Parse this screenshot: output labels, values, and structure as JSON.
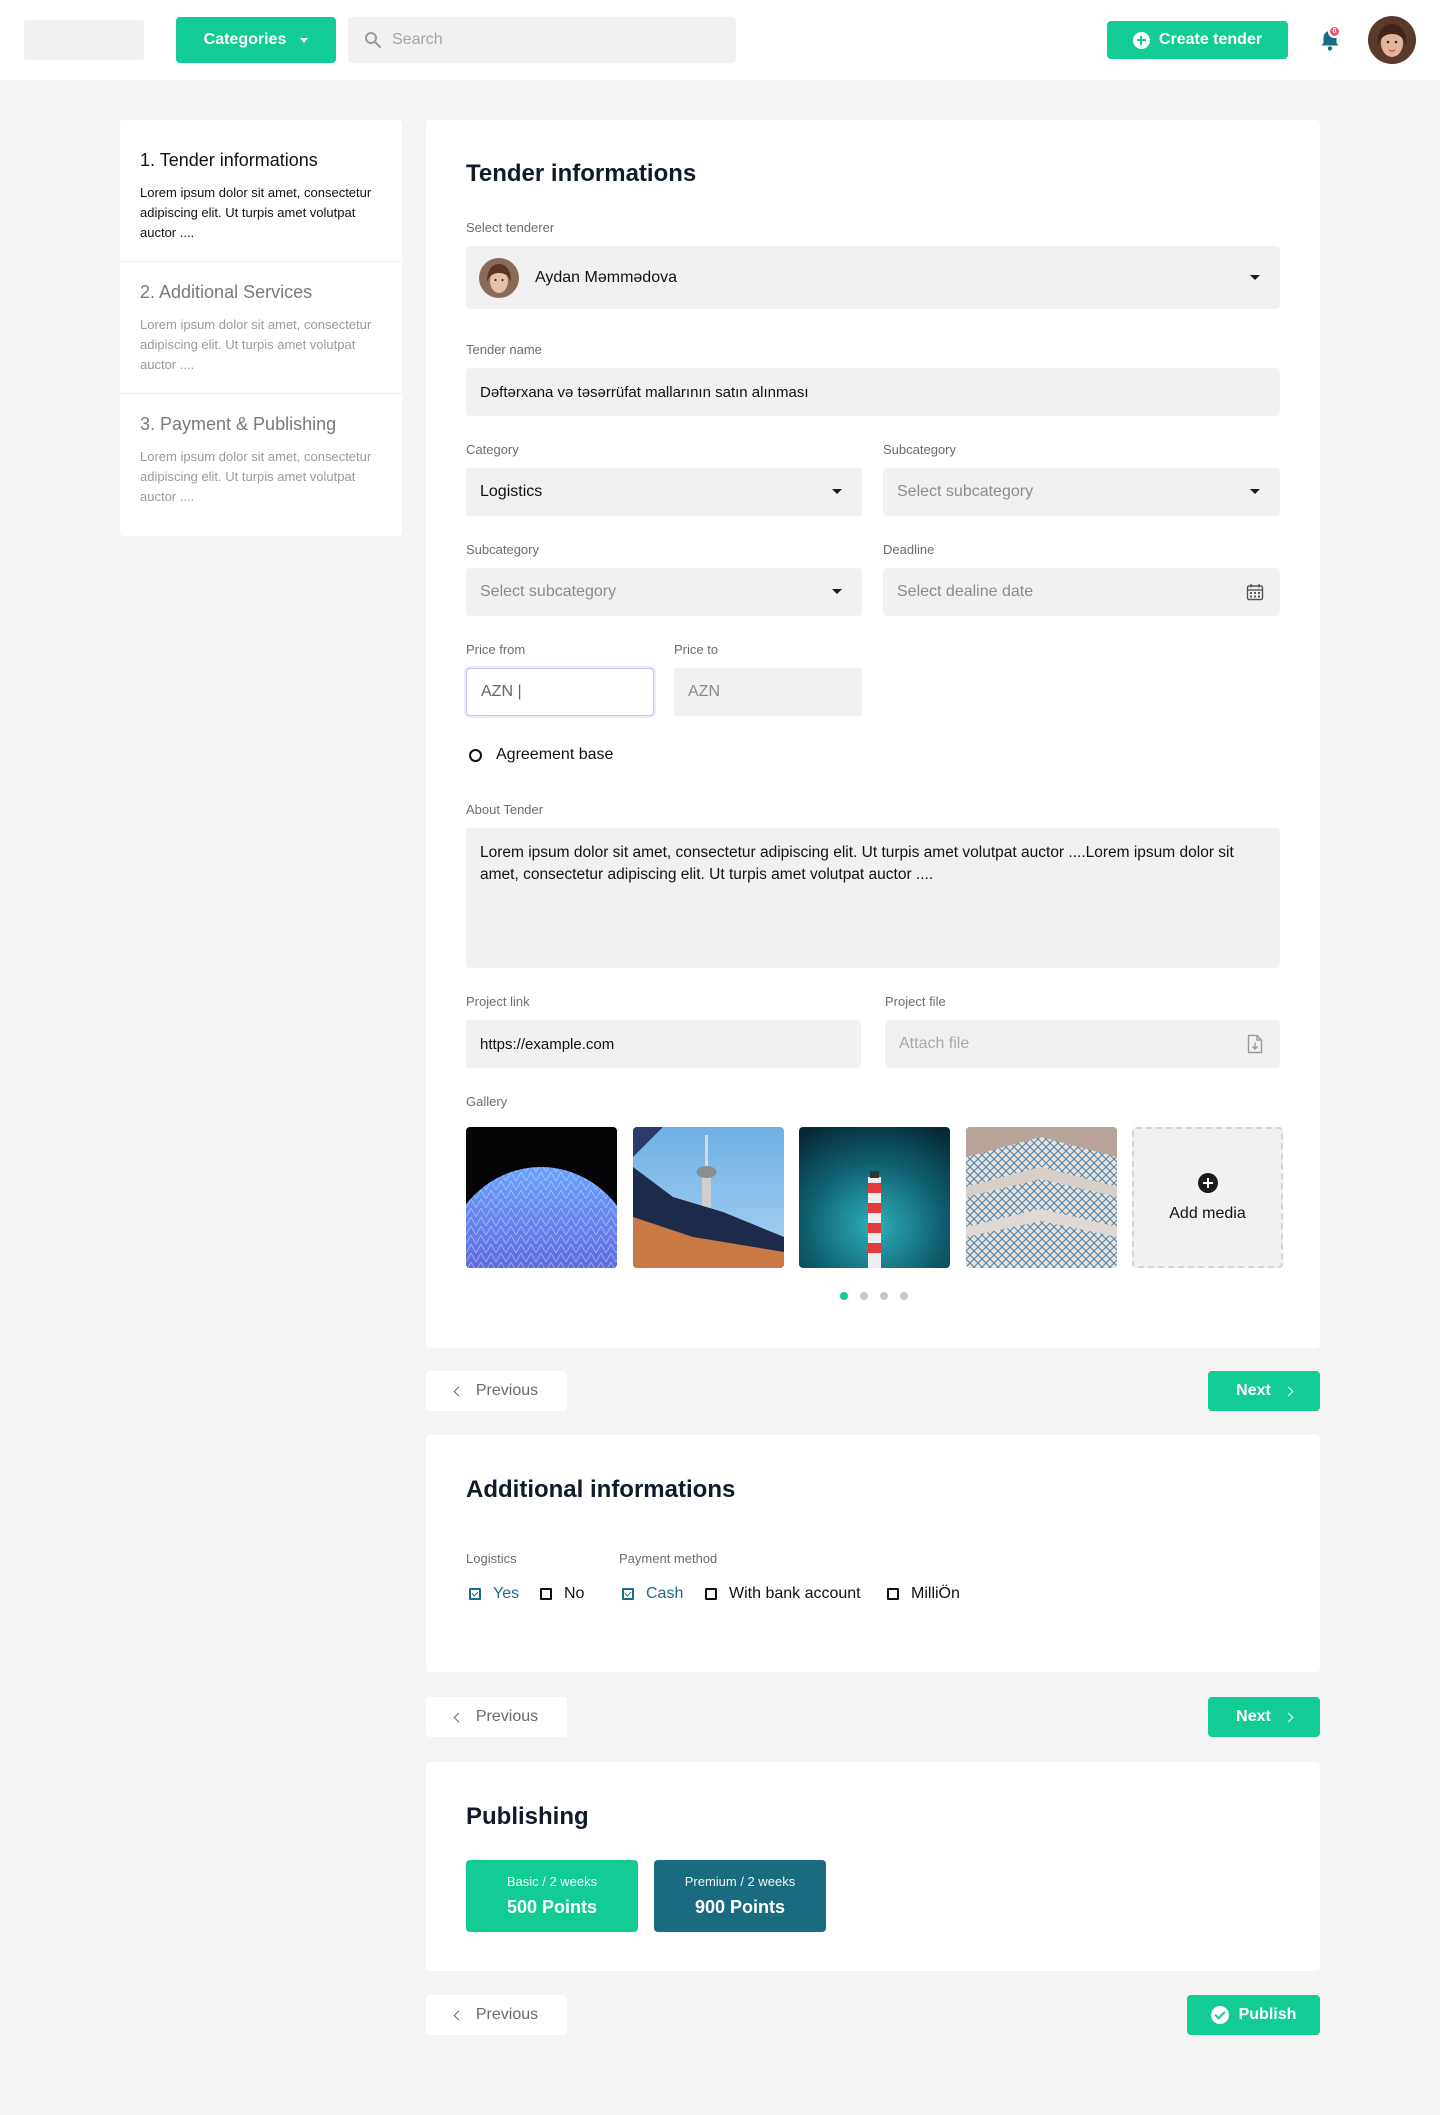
{
  "header": {
    "categories_label": "Categories",
    "search_placeholder": "Search",
    "create_label": "Create tender",
    "notification_count": "0"
  },
  "steps": [
    {
      "title": "1. Tender informations",
      "desc": "Lorem ipsum dolor sit amet, consectetur adipiscing elit. Ut turpis amet volutpat auctor ...."
    },
    {
      "title": "2. Additional Services",
      "desc": "Lorem ipsum dolor sit amet, consectetur adipiscing elit. Ut turpis amet volutpat auctor ...."
    },
    {
      "title": "3. Payment & Publishing",
      "desc": "Lorem ipsum dolor sit amet, consectetur adipiscing elit. Ut turpis amet volutpat auctor ...."
    }
  ],
  "tender": {
    "title": "Tender informations",
    "tenderer_label": "Select tenderer",
    "tenderer_value": "Aydan Məmmədova",
    "name_label": "Tender name",
    "name_value": "Dəftərxana və təsərrüfat mallarının satın alınması",
    "category_label": "Category",
    "category_value": "Logistics",
    "subcategory_label": "Subcategory",
    "subcategory_placeholder": "Select subcategory",
    "subcategory2_label": "Subcategory",
    "subcategory2_placeholder": "Select subcategory",
    "deadline_label": "Deadline",
    "deadline_placeholder": "Select dealine date",
    "price_from_label": "Price from",
    "price_from_value": "AZN |",
    "price_to_label": "Price to",
    "price_to_placeholder": "AZN",
    "agreement_label": "Agreement base",
    "about_label": "About Tender",
    "about_value": "Lorem ipsum dolor sit amet, consectetur adipiscing elit. Ut turpis amet volutpat auctor ....Lorem ipsum dolor sit amet, consectetur adipiscing elit. Ut turpis amet volutpat auctor ....",
    "link_label": "Project link",
    "link_value": "https://example.com",
    "file_label": "Project file",
    "file_placeholder": "Attach file",
    "gallery_label": "Gallery",
    "add_media_label": "Add media",
    "gallery_pages": 4,
    "gallery_active_page": 1
  },
  "nav": {
    "previous_label": "Previous",
    "next_label": "Next",
    "publish_label": "Publish"
  },
  "additional": {
    "title": "Additional informations",
    "logistics_label": "Logistics",
    "logistics_options": [
      {
        "label": "Yes",
        "checked": true
      },
      {
        "label": "No",
        "checked": false
      }
    ],
    "payment_label": "Payment method",
    "payment_options": [
      {
        "label": "Cash",
        "checked": true
      },
      {
        "label": "With bank account",
        "checked": false
      },
      {
        "label": "MilliÖn",
        "checked": false
      }
    ]
  },
  "publishing": {
    "title": "Publishing",
    "plans": [
      {
        "period": "Basic / 2 weeks",
        "points": "500 Points",
        "color": "#13cc95"
      },
      {
        "period": "Premium / 2 weeks",
        "points": "900 Points",
        "color": "#1a6b7f"
      }
    ]
  },
  "colors": {
    "accent": "#13cc95",
    "premium": "#1a6b7f",
    "checked": "#1f6a86",
    "badge": "#f0556d"
  }
}
